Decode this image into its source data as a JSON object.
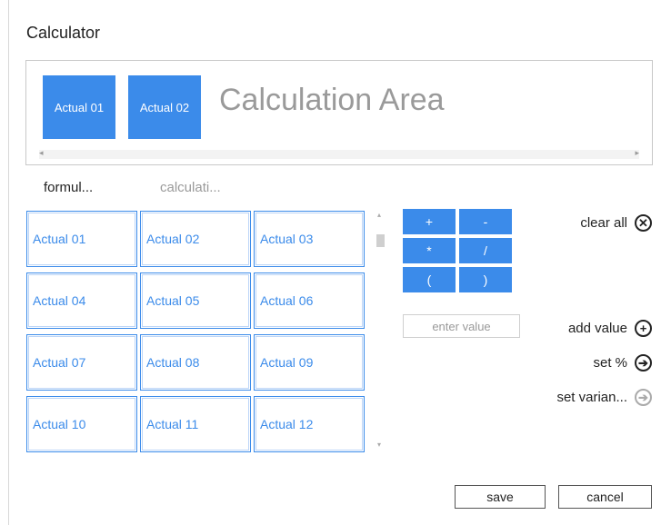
{
  "title": "Calculator",
  "calculation_area": {
    "tokens": [
      "Actual 01",
      "Actual 02"
    ],
    "placeholder": "Calculation Area"
  },
  "tabs": [
    {
      "label": "formul...",
      "active": true
    },
    {
      "label": "calculati...",
      "active": false
    }
  ],
  "grid_items": [
    "Actual 01",
    "Actual 02",
    "Actual 03",
    "Actual 04",
    "Actual 05",
    "Actual 06",
    "Actual 07",
    "Actual 08",
    "Actual 09",
    "Actual 10",
    "Actual 11",
    "Actual 12"
  ],
  "operators": [
    "+",
    "-",
    "*",
    "/",
    "(",
    ")"
  ],
  "enter_value": {
    "placeholder": "enter value",
    "value": ""
  },
  "actions": {
    "clear_all": "clear all",
    "add_value": "add value",
    "set_percent": "set %",
    "set_variance": "set varian..."
  },
  "buttons": {
    "save": "save",
    "cancel": "cancel"
  },
  "colors": {
    "accent": "#3b8bea",
    "muted_text": "#9a9a9a",
    "border": "#c8c8c8"
  }
}
